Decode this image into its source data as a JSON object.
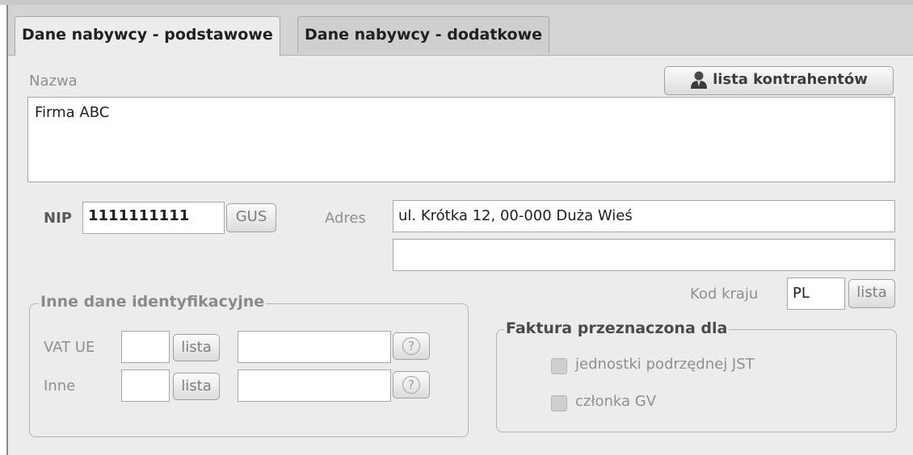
{
  "tabs": [
    {
      "label": "Dane nabywcy - podstawowe",
      "active": true
    },
    {
      "label": "Dane nabywcy - dodatkowe",
      "active": false
    }
  ],
  "nazwa": {
    "label": "Nazwa",
    "value": "Firma ABC",
    "lista_button": "lista kontrahentów"
  },
  "nip": {
    "label": "NIP",
    "value": "1111111111",
    "gus_button": "GUS"
  },
  "adres": {
    "label": "Adres",
    "line1": "ul. Krótka 12, 00-000 Duża Wieś",
    "line2": ""
  },
  "kod_kraju": {
    "label": "Kod kraju",
    "value": "PL",
    "lista_button": "lista"
  },
  "inne_dane": {
    "legend": "Inne dane identyfikacyjne",
    "vat_ue": {
      "label": "VAT UE",
      "code": "",
      "lista_button": "lista",
      "value": "",
      "help": "?"
    },
    "inne": {
      "label": "Inne",
      "code": "",
      "lista_button": "lista",
      "value": "",
      "help": "?"
    }
  },
  "faktura": {
    "legend": "Faktura przeznaczona dla",
    "options": [
      "jednostki podrzędnej JST",
      "członka GV"
    ]
  },
  "colors": {
    "panel_bg": "#ececec",
    "tabstrip_bg": "#d4d4d4",
    "disabled_text": "#8f8f8f"
  }
}
